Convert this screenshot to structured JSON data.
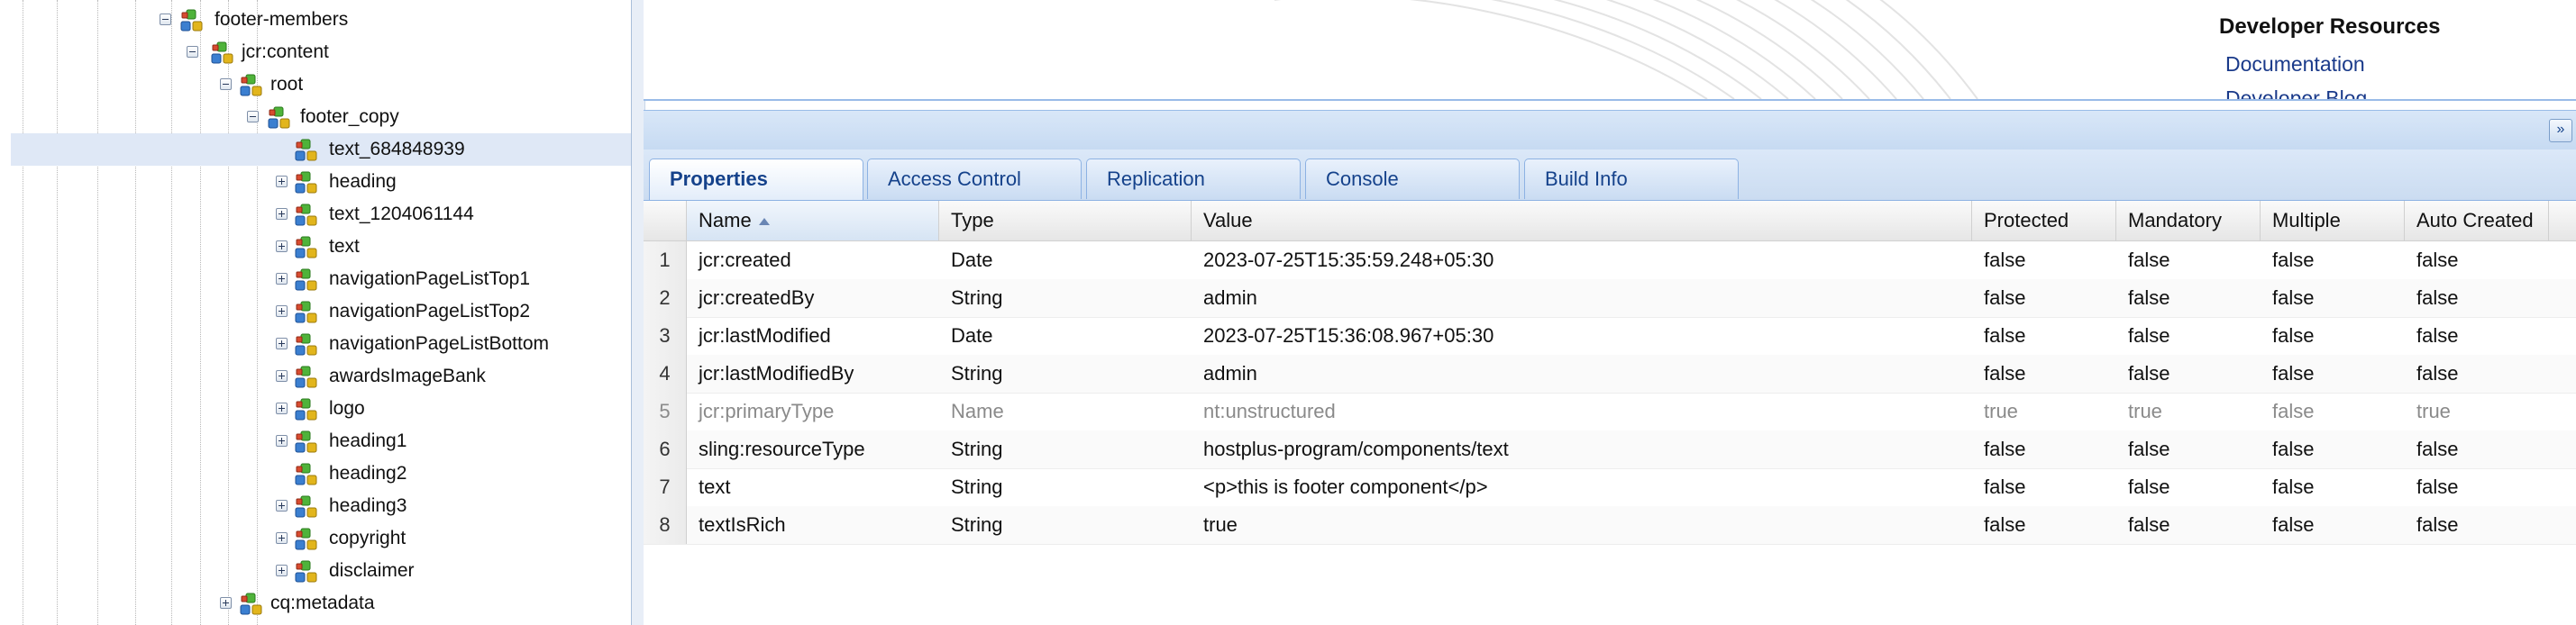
{
  "tree": {
    "nodes": [
      {
        "label": "footer-members",
        "toggle": "minus",
        "selected": false
      },
      {
        "label": "jcr:content",
        "toggle": "minus",
        "selected": false
      },
      {
        "label": "root",
        "toggle": "minus",
        "selected": false
      },
      {
        "label": "footer_copy",
        "toggle": "minus",
        "selected": false
      },
      {
        "label": "text_684848939",
        "toggle": "none",
        "selected": true
      },
      {
        "label": "heading",
        "toggle": "plus",
        "selected": false
      },
      {
        "label": "text_1204061144",
        "toggle": "plus",
        "selected": false
      },
      {
        "label": "text",
        "toggle": "plus",
        "selected": false
      },
      {
        "label": "navigationPageListTop1",
        "toggle": "plus",
        "selected": false
      },
      {
        "label": "navigationPageListTop2",
        "toggle": "plus",
        "selected": false
      },
      {
        "label": "navigationPageListBottom",
        "toggle": "plus",
        "selected": false
      },
      {
        "label": "awardsImageBank",
        "toggle": "plus",
        "selected": false
      },
      {
        "label": "logo",
        "toggle": "plus",
        "selected": false
      },
      {
        "label": "heading1",
        "toggle": "plus",
        "selected": false
      },
      {
        "label": "heading2",
        "toggle": "none",
        "selected": false
      },
      {
        "label": "heading3",
        "toggle": "plus",
        "selected": false
      },
      {
        "label": "copyright",
        "toggle": "plus",
        "selected": false
      },
      {
        "label": "disclaimer",
        "toggle": "plus",
        "selected": false
      },
      {
        "label": "cq:metadata",
        "toggle": "plus",
        "selected": false
      }
    ]
  },
  "developer_resources": {
    "title": "Developer Resources",
    "links": [
      "Documentation",
      "Developer Blog"
    ]
  },
  "tabs": [
    {
      "label": "Properties",
      "active": true
    },
    {
      "label": "Access Control",
      "active": false
    },
    {
      "label": "Replication",
      "active": false
    },
    {
      "label": "Console",
      "active": false
    },
    {
      "label": "Build Info",
      "active": false
    }
  ],
  "grid": {
    "columns": [
      "Name",
      "Type",
      "Value",
      "Protected",
      "Mandatory",
      "Multiple",
      "Auto Created"
    ],
    "sorted_column": "Name",
    "rows": [
      {
        "num": "1",
        "name": "jcr:created",
        "type": "Date",
        "value": "2023-07-25T15:35:59.248+05:30",
        "protected": "false",
        "mandatory": "false",
        "multiple": "false",
        "auto_created": "false",
        "muted": false
      },
      {
        "num": "2",
        "name": "jcr:createdBy",
        "type": "String",
        "value": "admin",
        "protected": "false",
        "mandatory": "false",
        "multiple": "false",
        "auto_created": "false",
        "muted": false
      },
      {
        "num": "3",
        "name": "jcr:lastModified",
        "type": "Date",
        "value": "2023-07-25T15:36:08.967+05:30",
        "protected": "false",
        "mandatory": "false",
        "multiple": "false",
        "auto_created": "false",
        "muted": false
      },
      {
        "num": "4",
        "name": "jcr:lastModifiedBy",
        "type": "String",
        "value": "admin",
        "protected": "false",
        "mandatory": "false",
        "multiple": "false",
        "auto_created": "false",
        "muted": false
      },
      {
        "num": "5",
        "name": "jcr:primaryType",
        "type": "Name",
        "value": "nt:unstructured",
        "protected": "true",
        "mandatory": "true",
        "multiple": "false",
        "auto_created": "true",
        "muted": true
      },
      {
        "num": "6",
        "name": "sling:resourceType",
        "type": "String",
        "value": "hostplus-program/components/text",
        "protected": "false",
        "mandatory": "false",
        "multiple": "false",
        "auto_created": "false",
        "muted": false
      },
      {
        "num": "7",
        "name": "text",
        "type": "String",
        "value": "<p>this is footer component</p>",
        "protected": "false",
        "mandatory": "false",
        "multiple": "false",
        "auto_created": "false",
        "muted": false
      },
      {
        "num": "8",
        "name": "textIsRich",
        "type": "String",
        "value": "true",
        "protected": "false",
        "mandatory": "false",
        "multiple": "false",
        "auto_created": "false",
        "muted": false
      }
    ]
  },
  "icons": {
    "node": "jcr-node-icon",
    "expand": "expand-toggle-icon",
    "collapse": "collapse-toggle-icon",
    "panel_collapse": "double-chevron-down-icon"
  },
  "colors": {
    "selection": "#dfe8f6",
    "tab_text": "#15428b",
    "link": "#1a3a8a"
  }
}
